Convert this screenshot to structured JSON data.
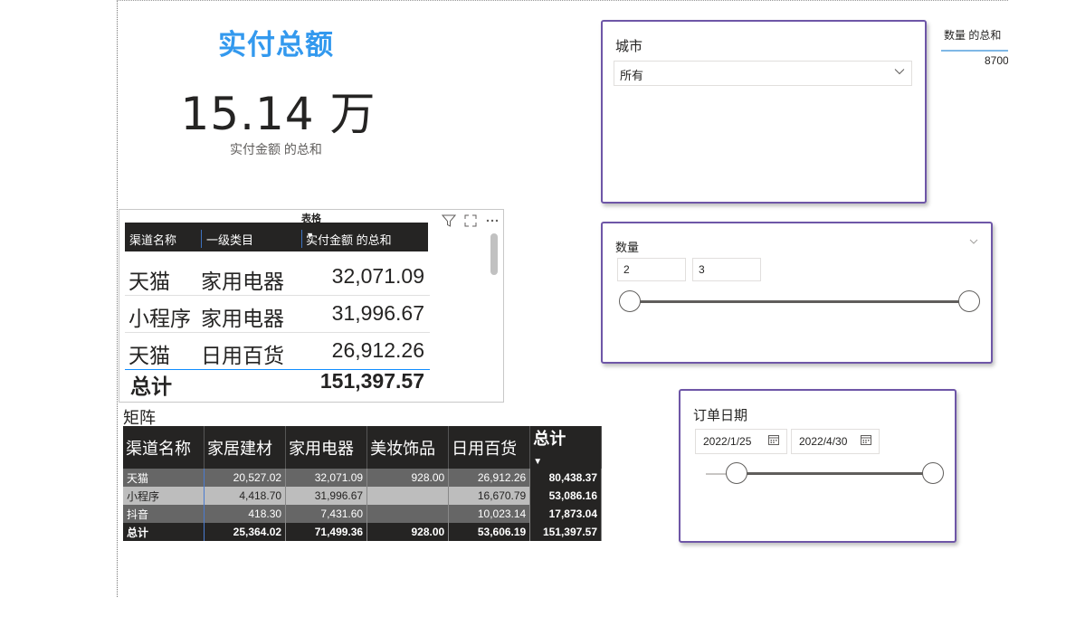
{
  "card": {
    "title": "实付总额",
    "value": "15.14 万",
    "caption": "实付金额 的总和"
  },
  "table_visual": {
    "title": "表格",
    "columns": [
      "渠道名称",
      "一级类目",
      "实付金额 的总和"
    ],
    "rows": [
      {
        "channel": "天猫",
        "category": "家用电器",
        "amount": "32,071.09"
      },
      {
        "channel": "小程序",
        "category": "家用电器",
        "amount": "31,996.67"
      },
      {
        "channel": "天猫",
        "category": "日用百货",
        "amount": "26,912.26"
      }
    ],
    "total_label": "总计",
    "total_value": "151,397.57",
    "icons": [
      "filter-icon",
      "focus-mode-icon",
      "more-options-icon"
    ]
  },
  "matrix": {
    "title": "矩阵",
    "headers": [
      "渠道名称",
      "家居建材",
      "家用电器",
      "美妆饰品",
      "日用百货",
      "总计"
    ],
    "rows": [
      [
        "天猫",
        "20,527.02",
        "32,071.09",
        "928.00",
        "26,912.26",
        "80,438.37"
      ],
      [
        "小程序",
        "4,418.70",
        "31,996.67",
        "",
        "16,670.79",
        "53,086.16"
      ],
      [
        "抖音",
        "418.30",
        "7,431.60",
        "",
        "10,023.14",
        "17,873.04"
      ],
      [
        "总计",
        "25,364.02",
        "71,499.36",
        "928.00",
        "53,606.19",
        "151,397.57"
      ]
    ]
  },
  "city_slicer": {
    "title": "城市",
    "selected": "所有"
  },
  "quantity_slicer": {
    "title": "数量",
    "min": "2",
    "max": "3"
  },
  "date_slicer": {
    "title": "订单日期",
    "start": "2022/1/25",
    "end": "2022/4/30"
  },
  "quantity_card": {
    "label": "数量 的总和",
    "value": "8700"
  },
  "colors": {
    "accent": "#3399ee",
    "slicer_border": "#6e56a7",
    "header_bg": "#252423"
  }
}
